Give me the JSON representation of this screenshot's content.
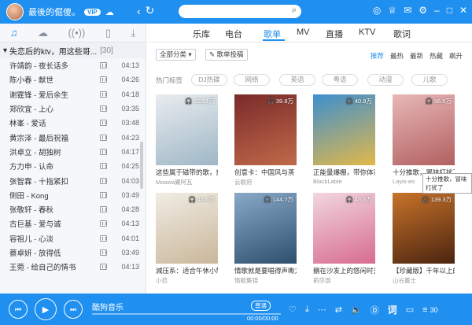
{
  "top": {
    "username": "最後的倔傻。",
    "vip": "VIP"
  },
  "left": {
    "playlist_title": "失恋后的ktv，用这些哥...",
    "playlist_count": "[30]",
    "songs": [
      {
        "name": "许靖韵 - 夜长话多",
        "dur": "04:13"
      },
      {
        "name": "陈小春 - 献世",
        "dur": "04:26"
      },
      {
        "name": "谢霆锋 - 爱后余生",
        "dur": "04:18"
      },
      {
        "name": "郑欣宜 - 上心",
        "dur": "03:35"
      },
      {
        "name": "林峯 - 爱话",
        "dur": "03:48"
      },
      {
        "name": "黄宗泽 - 最后祝福",
        "dur": "04:23"
      },
      {
        "name": "洪卓立 - 胡独树",
        "dur": "04:17"
      },
      {
        "name": "方力申 - 认命",
        "dur": "04:25"
      },
      {
        "name": "张智霖 - 十指紧扣",
        "dur": "04:03"
      },
      {
        "name": "侧田 - Kong",
        "dur": "03:49"
      },
      {
        "name": "张敬轩 - 春秋",
        "dur": "04:28"
      },
      {
        "name": "古巨基 - 爱与诚",
        "dur": "04:13"
      },
      {
        "name": "容祖儿 - 心淡",
        "dur": "04:01"
      },
      {
        "name": "蔡卓妍 - 放得低",
        "dur": "03:49"
      },
      {
        "name": "王菀 - 给自己的情书",
        "dur": "04:13"
      }
    ]
  },
  "nav": {
    "tabs": [
      "乐库",
      "电台",
      "歌单",
      "MV",
      "直播",
      "KTV",
      "歌词"
    ]
  },
  "filter": {
    "all_categories": "全部分类",
    "submit": "歌单投稿",
    "sort": [
      "推荐",
      "最热",
      "最新",
      "热藏",
      "飙升"
    ],
    "hot_tags_label": "热门标签",
    "tags": [
      "DJ热碟",
      "网络",
      "英语",
      "粤语",
      "动漫",
      "儿歌"
    ]
  },
  "cards": [
    {
      "plays": "222.1万",
      "title": "这些属于磁带的歌，刻",
      "author": "Moawa翼阿瓦",
      "colors": [
        "#e9ecef",
        "#9fb7c6"
      ]
    },
    {
      "plays": "39.8万",
      "title": "创意卡：中国风与蒸",
      "author": "云歌府",
      "colors": [
        "#7a2a2a",
        "#c06a4a"
      ]
    },
    {
      "plays": "40.8万",
      "title": "正能量爆棚，带你体验",
      "author": "BlackLable",
      "colors": [
        "#3d8fd0",
        "#e2b84a"
      ]
    },
    {
      "plays": "96.5万",
      "title": "十分推歌，冒味打扰了",
      "author": "Layis-eo",
      "colors": [
        "#e8b7b7",
        "#b26060"
      ]
    },
    {
      "plays": "44.6万",
      "title": "減压系：适合午休小憩",
      "author": "小范",
      "colors": [
        "#f1ece4",
        "#c9b79a"
      ]
    },
    {
      "plays": "144.7万",
      "title": "情歌就是要唱得声嘶力",
      "author": "情歌集锦",
      "colors": [
        "#88a9c8",
        "#2f4f6f"
      ]
    },
    {
      "plays": "46.6万",
      "title": "躺在沙发上的悠闲时光",
      "author": "莉莎游",
      "colors": [
        "#f1d7e0",
        "#d86b8f"
      ]
    },
    {
      "plays": "139.3万",
      "title": "【珍藏版】千年以上的",
      "author": "山谷蓄士",
      "colors": [
        "#c8732a",
        "#4a2410"
      ]
    }
  ],
  "tooltip": "十分推歌，冒味打扰了",
  "player": {
    "now_playing": "酷狗音乐",
    "quality": "普通",
    "time": "00:00/00:00",
    "lyric_btn": "词",
    "queue_count": "30"
  }
}
